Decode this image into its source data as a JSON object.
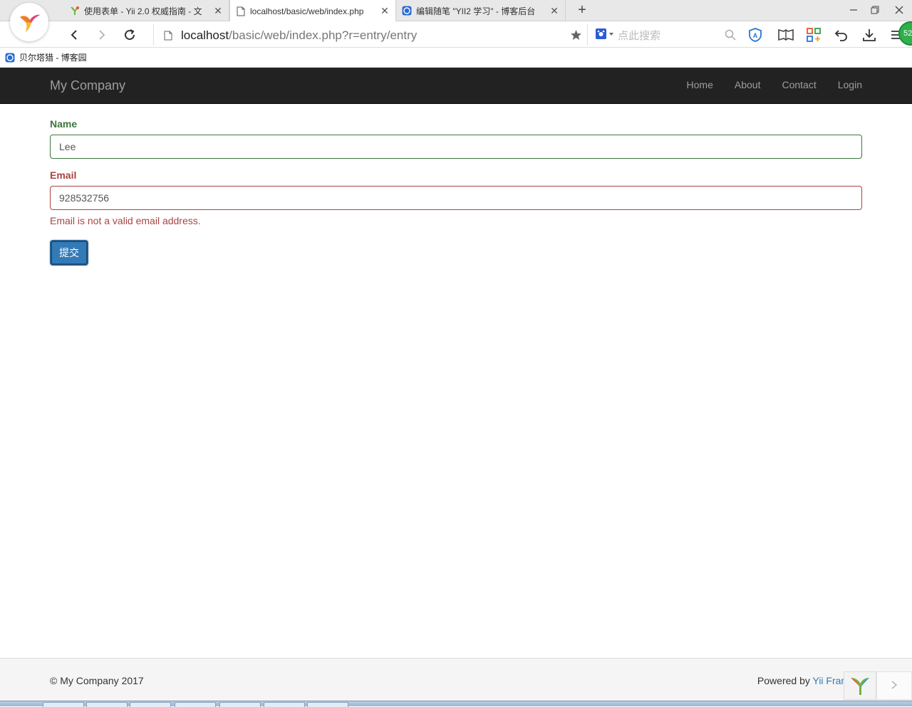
{
  "browser": {
    "tabs": [
      {
        "title": "使用表单 - Yii 2.0 权威指南 - 文",
        "icon": "yii-favicon-icon"
      },
      {
        "title": "localhost/basic/web/index.php",
        "icon": "page-icon",
        "active": true
      },
      {
        "title": "编辑随笔 \"YII2 学习\" - 博客后台",
        "icon": "cnblogs-icon"
      }
    ],
    "close_glyph": "✕",
    "new_tab_glyph": "+",
    "address": {
      "host": "localhost",
      "path": "/basic/web/index.php?r=entry/entry"
    },
    "search_placeholder": "点此搜索",
    "bookmarks": [
      {
        "label": "贝尔塔猎 - 博客园",
        "icon": "cnblogs-icon"
      }
    ],
    "badge": "52"
  },
  "site": {
    "brand": "My Company",
    "nav": [
      "Home",
      "About",
      "Contact",
      "Login"
    ]
  },
  "form": {
    "name_label": "Name",
    "name_value": "Lee",
    "email_label": "Email",
    "email_value": "928532756",
    "email_error": "Email is not a valid email address.",
    "submit_label": "提交"
  },
  "footer": {
    "copyright": "© My Company 2017",
    "powered_prefix": "Powered by ",
    "powered_link": "Yii Framew"
  },
  "colors": {
    "navbar_bg": "#222222",
    "success": "#3c763d",
    "error": "#a94442",
    "primary": "#337ab7"
  }
}
